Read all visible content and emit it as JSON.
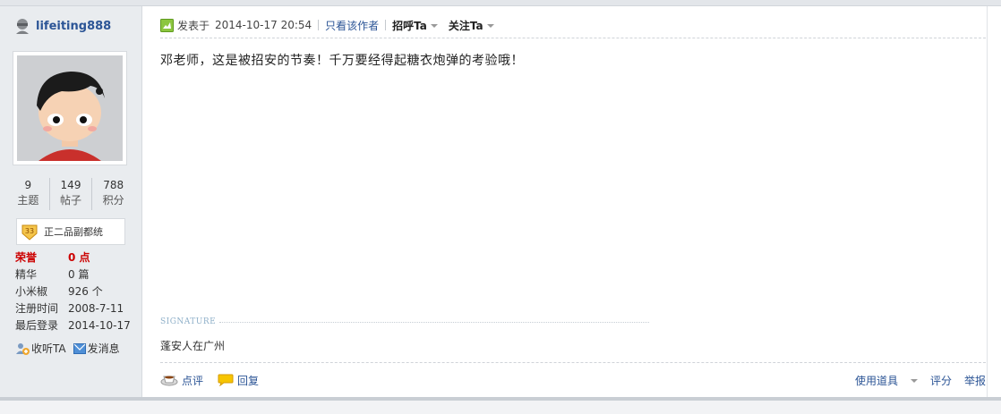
{
  "user": {
    "name": "lifeiting888",
    "stats": [
      {
        "value": "9",
        "label": "主题"
      },
      {
        "value": "149",
        "label": "帖子"
      },
      {
        "value": "788",
        "label": "积分"
      }
    ],
    "rank_level": "33",
    "rank_title": "正二品副都统",
    "info": [
      {
        "key": "荣誉",
        "value": "0 点"
      },
      {
        "key": "精华",
        "value": "0 篇"
      },
      {
        "key": "小米椒",
        "value": "926 个"
      },
      {
        "key": "注册时间",
        "value": "2008-7-11"
      },
      {
        "key": "最后登录",
        "value": "2014-10-17"
      }
    ],
    "actions": {
      "follow": "收听TA",
      "message": "发消息"
    }
  },
  "post": {
    "posted_prefix": "发表于",
    "posted_time": "2014-10-17 20:54",
    "only_author": "只看该作者",
    "greet": "招呼Ta",
    "follow": "关注Ta",
    "content": "邓老师，这是被招安的节奏！千万要经得起糖衣炮弹的考验哦！",
    "signature_label": "SIGNATURE",
    "signature": "蓬安人在广州"
  },
  "footer": {
    "rate": "点评",
    "reply": "回复",
    "tools": "使用道具",
    "score": "评分",
    "report": "举报"
  },
  "colors": {
    "link": "#2c5596",
    "honor": "#cc0000",
    "sidebar_bg": "#e9ecef"
  }
}
